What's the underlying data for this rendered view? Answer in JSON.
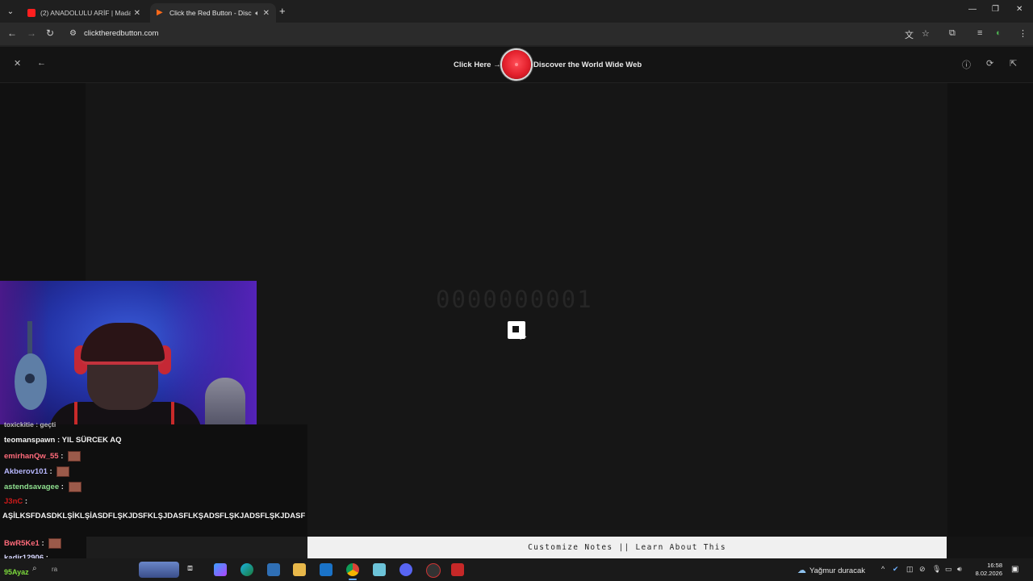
{
  "browser": {
    "tabs": [
      {
        "title": "(2) ANADOLULU ARİF | Madara",
        "active": false,
        "favicon_color": "#ff1f1f"
      },
      {
        "title": "Click the Red Button - Disco",
        "active": true,
        "favicon_color": "#ff6a1a"
      }
    ],
    "url": "clicktheredbutton.com"
  },
  "page": {
    "click_here": "Click Here →",
    "discover": "Discover the World Wide Web",
    "counter": "0000000001",
    "notes_bar": "Customize Notes || Learn About This"
  },
  "chat": {
    "partial_top": "toxickitie : geçti",
    "messages": [
      {
        "user": "teomanspawn",
        "text": "YIL SÜRCEK AQ",
        "color": "#f2f2f2",
        "emote": false
      },
      {
        "user": "emirhanQw_55",
        "text": "",
        "color": "#ff6a7a",
        "emote": true
      },
      {
        "user": "Akberov101",
        "text": "",
        "color": "#b8b8ff",
        "emote": true
      },
      {
        "user": "astendsavagee",
        "text": "",
        "color": "#8fe08f",
        "emote": true
      },
      {
        "user": "J3nC",
        "text": "",
        "color": "#d01a1a",
        "emote": false
      },
      {
        "user": "BwR5Ke1",
        "text": "",
        "color": "#ff6a7a",
        "emote": true
      },
      {
        "user": "kadir12906",
        "text": "",
        "color": "#d7d7ff",
        "emote": false
      }
    ],
    "long_message": "AŞİLKSFDASDKLŞİKLŞİASDFLŞKJDSFKLŞJDASFLKŞADSFLŞKJADSFLŞKJDASF",
    "bottom_user": "95Ayaz"
  },
  "taskbar": {
    "weather": "Yağmur duracak",
    "time": "16:58",
    "date": "8.02.2026",
    "search_hint": "ra"
  },
  "colors": {
    "red_button": "#e3202c",
    "background": "#141414",
    "notes_bar": "#f0f0f0"
  }
}
